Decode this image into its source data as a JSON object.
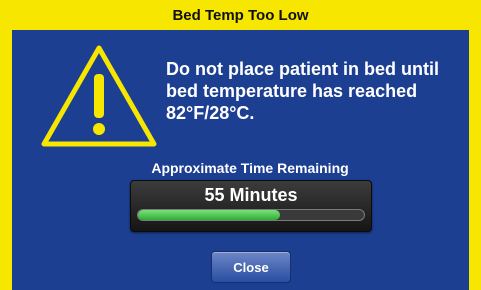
{
  "dialog": {
    "title": "Bed Temp Too Low",
    "message": "Do not place patient in bed until bed temperature has reached 82°F/28°C.",
    "timer": {
      "label": "Approximate Time Remaining",
      "value_text": "55 Minutes",
      "progress_fraction": 0.63
    },
    "close_label": "Close",
    "icon": "warning-triangle-icon"
  },
  "colors": {
    "frame": "#f6e600",
    "panel": "#1c3f92",
    "warning_icon": "#f6e600",
    "progress": "#2fae33"
  }
}
